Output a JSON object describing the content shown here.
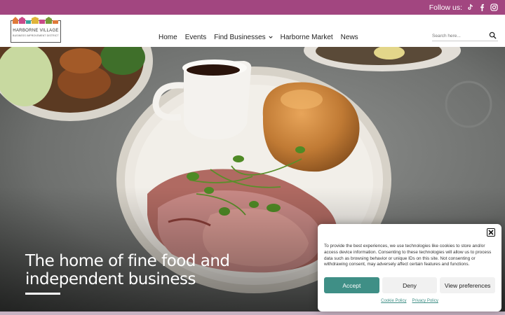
{
  "topbar": {
    "follow_label": "Follow us:",
    "socials": [
      "tiktok-icon",
      "facebook-icon",
      "instagram-icon"
    ],
    "bg_color": "#a24680"
  },
  "logo": {
    "title": "HARBORNE VILLAGE",
    "subtitle": "BUSINESS IMPROVEMENT DISTRICT"
  },
  "nav": {
    "items": [
      "Home",
      "Events",
      "Find Businesses",
      "Harborne Market",
      "News"
    ]
  },
  "search": {
    "placeholder": "Search here..."
  },
  "hero": {
    "title_line1": "The home of fine food and",
    "title_line2": "independent business"
  },
  "cookie": {
    "text": "To provide the best experiences, we use technologies like cookies to store and/or access device information. Consenting to these technologies will allow us to process data such as browsing behavior or unique IDs on this site. Not consenting or withdrawing consent, may adversely affect certain features and functions.",
    "accept_label": "Accept",
    "deny_label": "Deny",
    "prefs_label": "View preferences",
    "cookie_policy_label": "Cookie Policy",
    "privacy_policy_label": "Privacy Policy",
    "accent_color": "#3f8f86"
  }
}
